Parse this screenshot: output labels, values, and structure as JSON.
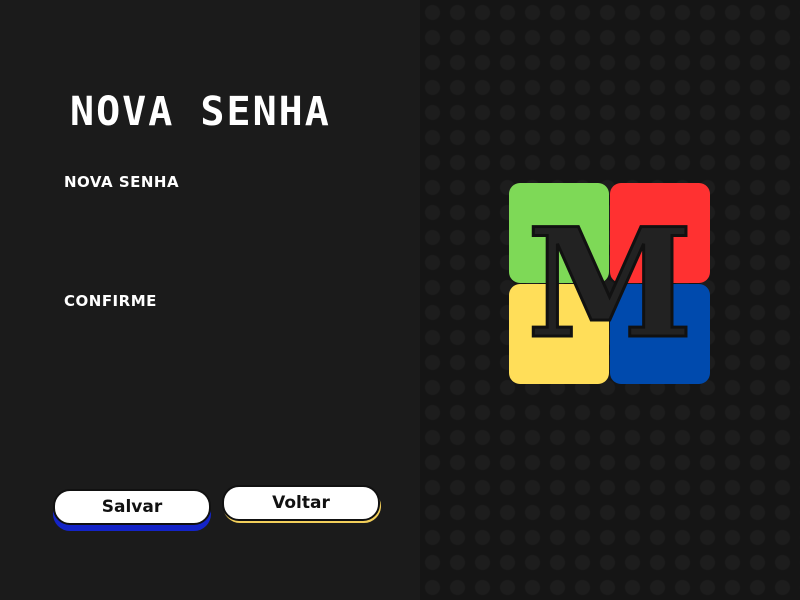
{
  "form": {
    "title": "NOVA SENHA",
    "new_password_label": "NOVA SENHA",
    "confirm_label": "CONFIRME",
    "new_password_value": "",
    "confirm_value": ""
  },
  "buttons": {
    "save_label": "Salvar",
    "back_label": "Voltar",
    "save_shadow_color": "#1424c8",
    "back_shadow_color": "#f3cf5a"
  },
  "logo": {
    "letter": "M",
    "colors": {
      "top_left": "#7ed957",
      "top_right": "#ff3131",
      "bottom_left": "#ffde59",
      "bottom_right": "#004aad"
    }
  },
  "theme": {
    "background": "#1b1b1b",
    "text": "#ffffff"
  }
}
